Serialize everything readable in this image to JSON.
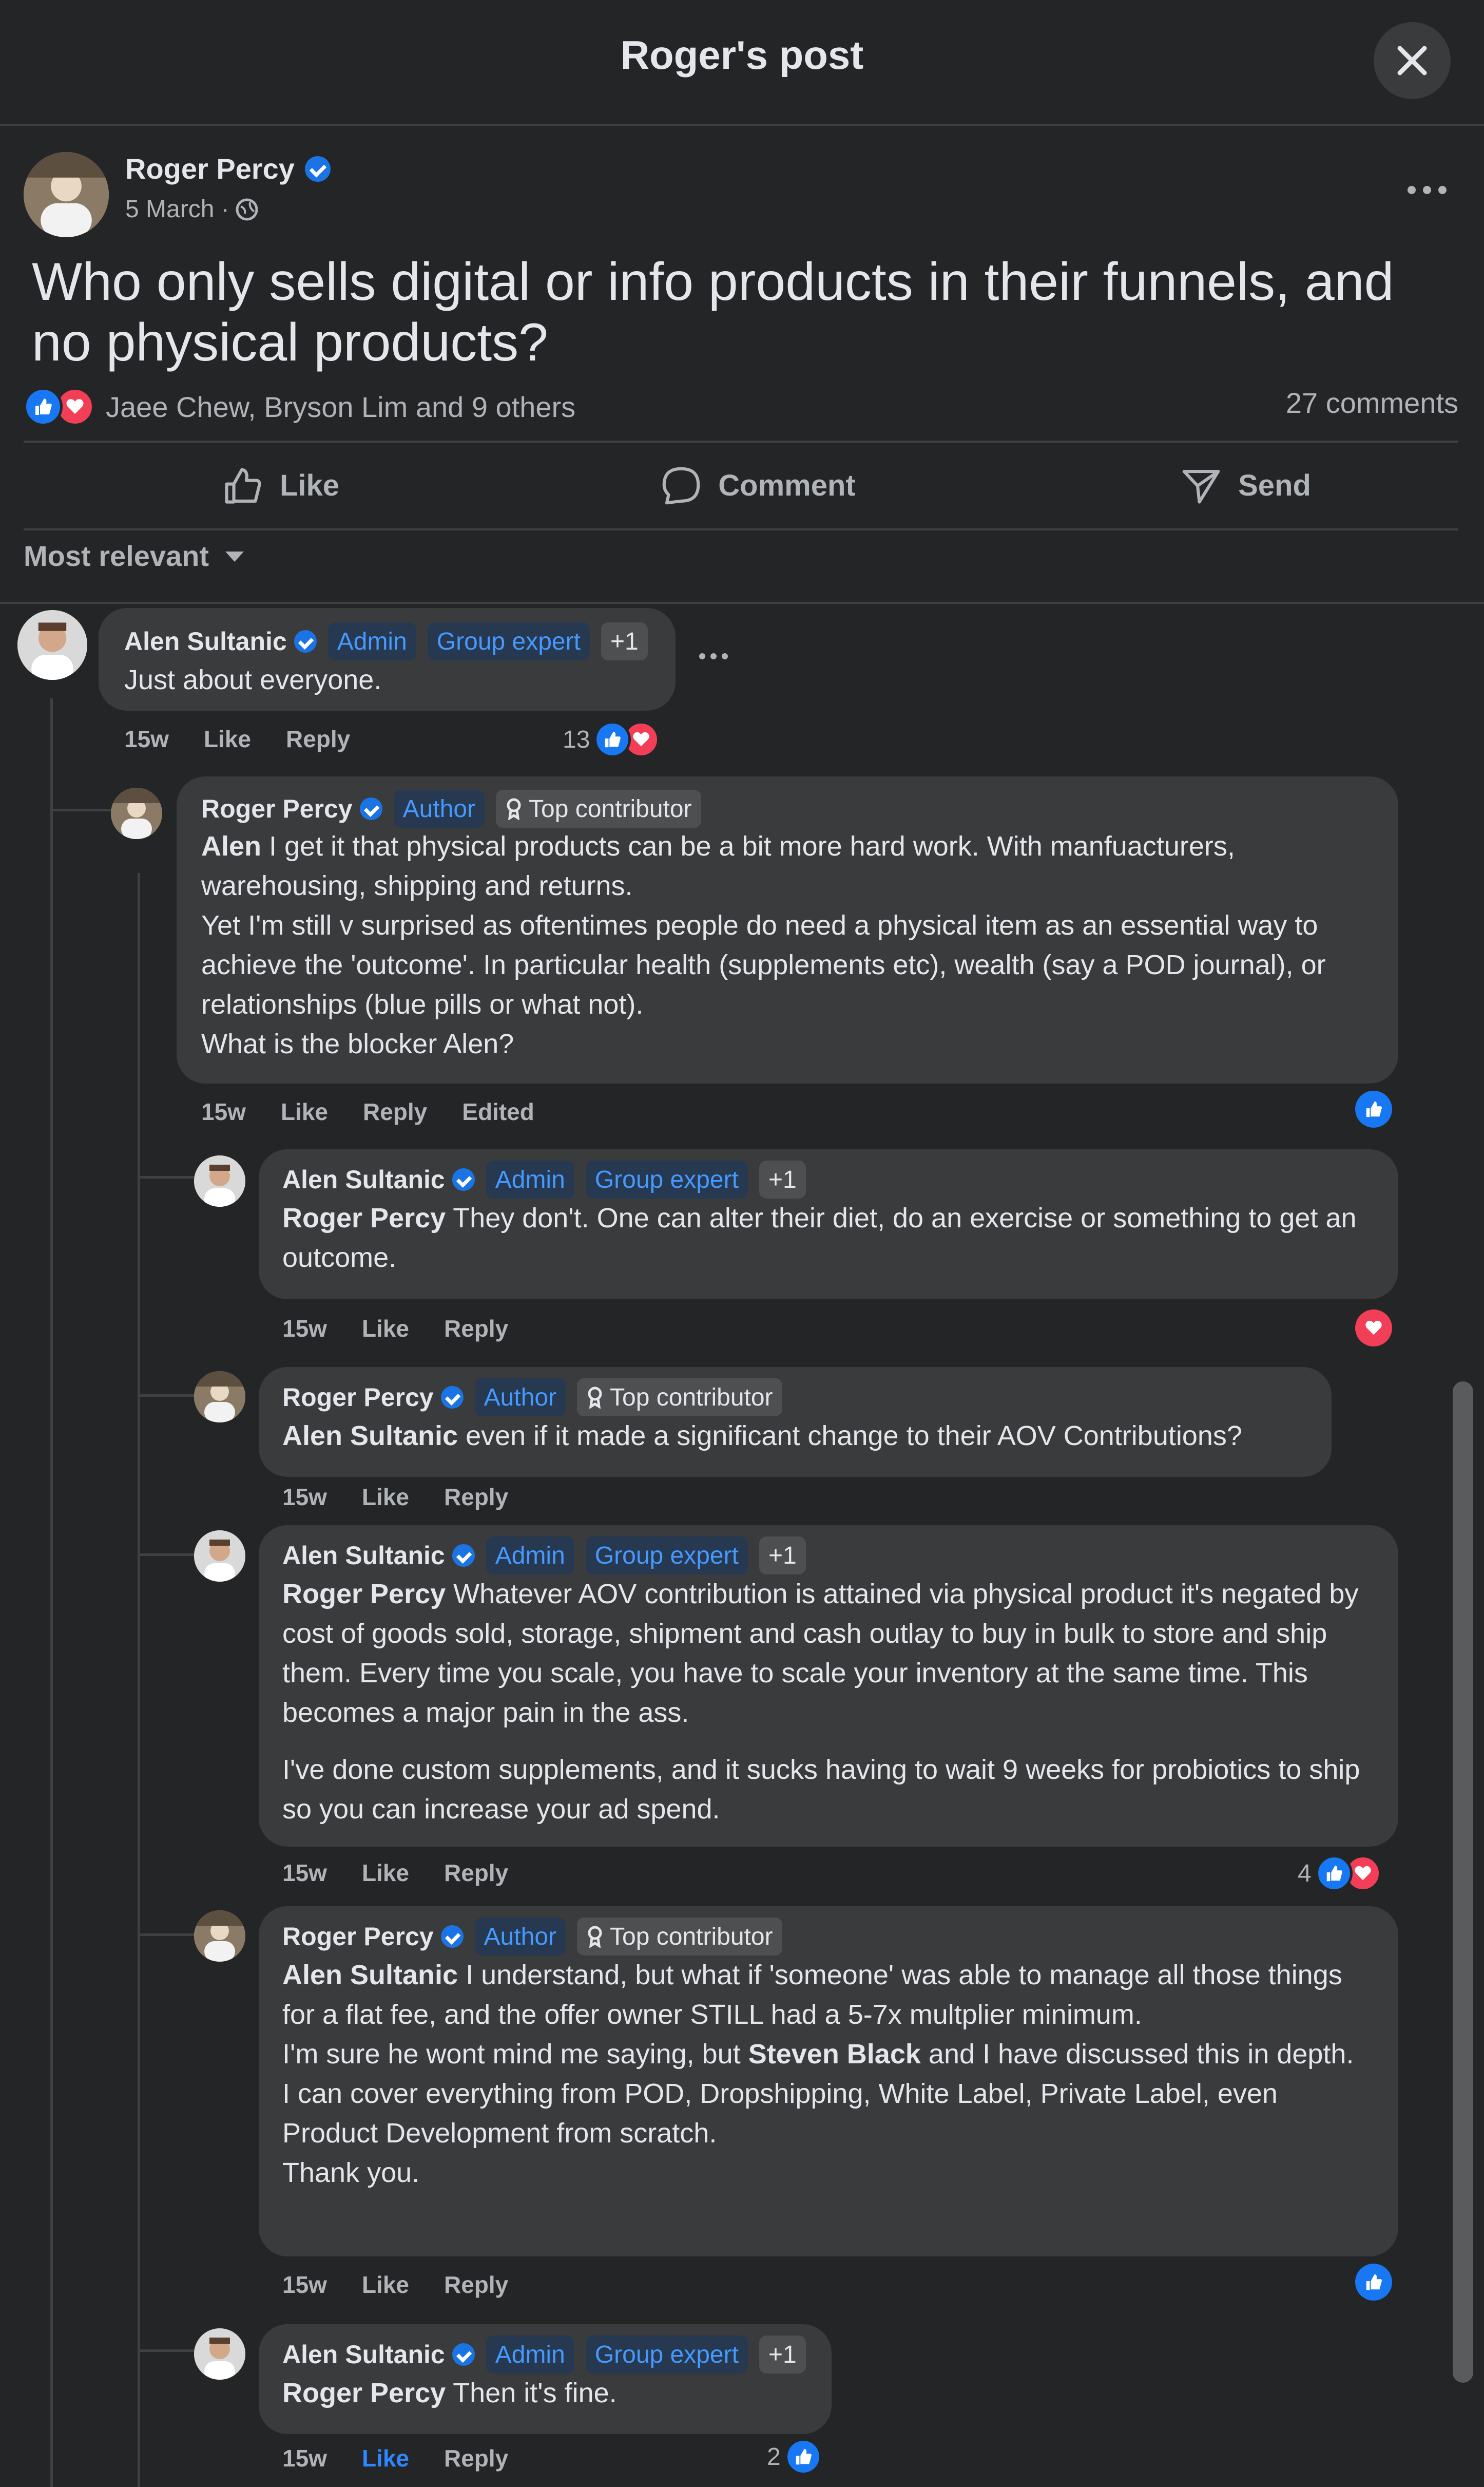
{
  "header": {
    "title": "Roger's post"
  },
  "post": {
    "author": "Roger Percy",
    "date": "5 March ·",
    "text": "Who only sells digital or info products in their funnels, and no physical products?",
    "reactions_summary": "Jaee Chew, Bryson Lim and 9 others",
    "comments_count": "27 comments"
  },
  "actions": {
    "like": "Like",
    "comment": "Comment",
    "send": "Send"
  },
  "sort": {
    "label": "Most relevant"
  },
  "comments": [
    {
      "author": "Alen Sultanic",
      "badges": [
        "Admin",
        "Group expert",
        "+1"
      ],
      "text": "Just about everyone.",
      "time": "15w",
      "like": "Like",
      "reply": "Reply",
      "reaction_count": "13",
      "reactions": [
        "like",
        "love"
      ]
    },
    {
      "author": "Roger Percy",
      "badges": [
        "Author",
        "Top contributor"
      ],
      "mention": "Alen",
      "text": "I get it that physical products can be a bit more hard work. With manfuacturers, warehousing, shipping and returns.",
      "text2": "Yet I'm still v surprised as oftentimes people do need a physical item as an essential way to achieve the 'outcome'. In particular health (supplements etc), wealth (say a POD journal), or relationships (blue pills or what not).",
      "text3": "What is the blocker Alen?",
      "time": "15w",
      "like": "Like",
      "reply": "Reply",
      "edited": "Edited",
      "reactions": [
        "like"
      ]
    },
    {
      "author": "Alen Sultanic",
      "badges": [
        "Admin",
        "Group expert",
        "+1"
      ],
      "mention": "Roger Percy",
      "text": "They don't. One can alter their diet, do an exercise or something to get an outcome.",
      "time": "15w",
      "like": "Like",
      "reply": "Reply",
      "reactions": [
        "love"
      ]
    },
    {
      "author": "Roger Percy",
      "badges": [
        "Author",
        "Top contributor"
      ],
      "mention": "Alen Sultanic",
      "text": "even if it made a significant change to their AOV Contributions?",
      "time": "15w",
      "like": "Like",
      "reply": "Reply"
    },
    {
      "author": "Alen Sultanic",
      "badges": [
        "Admin",
        "Group expert",
        "+1"
      ],
      "mention": "Roger Percy",
      "text": "Whatever AOV contribution is attained via physical product it's negated by cost of goods sold, storage, shipment and cash outlay to buy in bulk to store and ship them. Every time you scale, you have to scale your inventory at the same time. This becomes a major pain in the ass.",
      "text2": "I've done custom supplements, and it sucks having to wait 9 weeks for probiotics to ship so you can increase your ad spend.",
      "time": "15w",
      "like": "Like",
      "reply": "Reply",
      "reaction_count": "4",
      "reactions": [
        "like",
        "love"
      ]
    },
    {
      "author": "Roger Percy",
      "badges": [
        "Author",
        "Top contributor"
      ],
      "mention": "Alen Sultanic",
      "text": "I understand, but what if 'someone' was able to manage all those things for a flat fee, and the offer owner STILL had a 5-7x multplier minimum.",
      "text2a": "I'm sure he wont mind me saying, but ",
      "text2_mention": "Steven Black",
      "text2b": " and I have discussed this in depth.",
      "text3": "I can cover everything from POD, Dropshipping, White Label, Private Label, even Product Development from scratch.",
      "text4": "Thank you.",
      "time": "15w",
      "like": "Like",
      "reply": "Reply",
      "reactions": [
        "like"
      ]
    },
    {
      "author": "Alen Sultanic",
      "badges": [
        "Admin",
        "Group expert",
        "+1"
      ],
      "mention": "Roger Percy",
      "text": "Then it's fine.",
      "time": "15w",
      "like": "Like",
      "reply": "Reply",
      "reaction_count": "2",
      "reactions": [
        "like"
      ]
    }
  ],
  "icons": {
    "close": "close-icon",
    "globe": "globe-icon",
    "more": "more-icon",
    "like": "thumbs-up-icon",
    "comment": "comment-icon",
    "send": "send-icon",
    "chevron": "chevron-down-icon",
    "verified": "verified-badge-icon",
    "contributor": "contributor-icon"
  },
  "colors": {
    "background": "#242526",
    "bubble": "#3a3b3c",
    "accent": "#1877f2",
    "love": "#f33e58",
    "badge_blue_text": "#4599ff"
  }
}
